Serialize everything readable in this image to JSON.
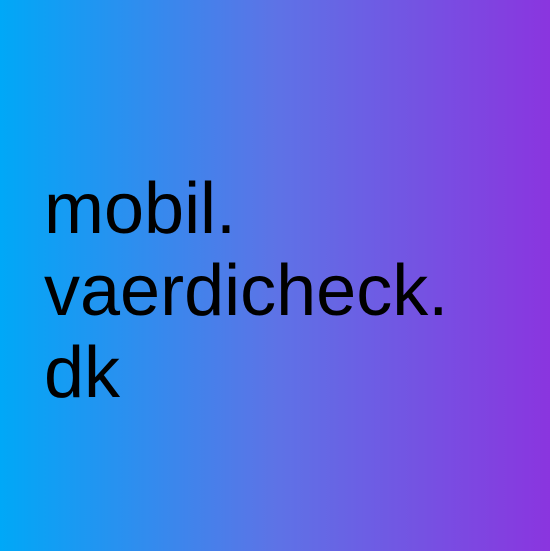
{
  "background": {
    "gradient_start": "#00a8f7",
    "gradient_mid": "#5d73e6",
    "gradient_end": "#8a35df"
  },
  "logo_text": {
    "line1": "mobil.",
    "line2": "vaerdicheck.",
    "line3": "dk"
  }
}
